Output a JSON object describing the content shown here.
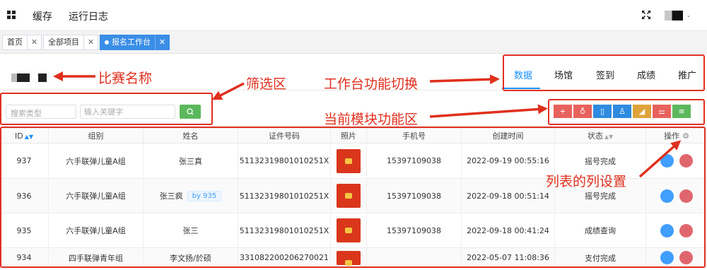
{
  "topbar": {
    "menu": [
      "缓存",
      "运行日志"
    ],
    "user_caret": "."
  },
  "tabs": [
    {
      "label": "首页",
      "close": "✕"
    },
    {
      "label": "全部项目",
      "close": "✕"
    },
    {
      "label": "报名工作台",
      "close": "✕",
      "active": true
    }
  ],
  "function_tabs": [
    "数据",
    "场馆",
    "签到",
    "成绩",
    "推广"
  ],
  "search": {
    "type_placeholder": "搜索类型",
    "keyword_placeholder": "输入关键字"
  },
  "toolbar_buttons": [
    {
      "icon": "plus-icon",
      "glyph": "+",
      "color": "#e8625d"
    },
    {
      "icon": "medal-icon",
      "glyph": "♁",
      "color": "#e8625d"
    },
    {
      "icon": "tablet-icon",
      "glyph": "▯",
      "color": "#2f8be0"
    },
    {
      "icon": "user-icon",
      "glyph": "♙",
      "color": "#2f8be0"
    },
    {
      "icon": "signal-icon",
      "glyph": "◢",
      "color": "#e0a33b"
    },
    {
      "icon": "sliders-icon",
      "glyph": "⚌",
      "color": "#e8625d"
    },
    {
      "icon": "list-icon",
      "glyph": "≡",
      "color": "#5cb85c"
    }
  ],
  "table": {
    "columns": [
      "ID",
      "组别",
      "姓名",
      "证件号码",
      "照片",
      "手机号",
      "创建时间",
      "状态",
      "操作"
    ],
    "rows": [
      {
        "id": "937",
        "group": "六手联弹儿童A组",
        "name": "张三真",
        "tag": "",
        "id_no": "51132319801010251X",
        "phone": "15397109038",
        "created": "2022-09-19 00:55:16",
        "status": "摇号完成"
      },
      {
        "id": "936",
        "group": "六手联弹儿童A组",
        "name": "张三疯",
        "tag": "by 935",
        "id_no": "51132319801010251X",
        "phone": "15397109038",
        "created": "2022-09-18 00:51:14",
        "status": "摇号完成"
      },
      {
        "id": "935",
        "group": "六手联弹儿童A组",
        "name": "张三",
        "tag": "",
        "id_no": "51132319801010251X",
        "phone": "15397109038",
        "created": "2022-09-18 00:41:24",
        "status": "成绩查询"
      },
      {
        "id": "934",
        "group": "四手联弹青年组",
        "name": "李文扬/於硕",
        "tag": "",
        "id_no": "331082200206270021",
        "phone": "",
        "created": "2022-05-07 11:08:36",
        "status": "支付完成"
      }
    ]
  },
  "annotations": {
    "race_name": "比赛名称",
    "filter_area": "筛选区",
    "func_switch": "工作台功能切换",
    "module_area": "当前模块功能区",
    "column_settings": "列表的列设置"
  },
  "colors": {
    "primary": "#1890ff",
    "annotation": "#e0301e",
    "search_button": "#5cb85c"
  }
}
